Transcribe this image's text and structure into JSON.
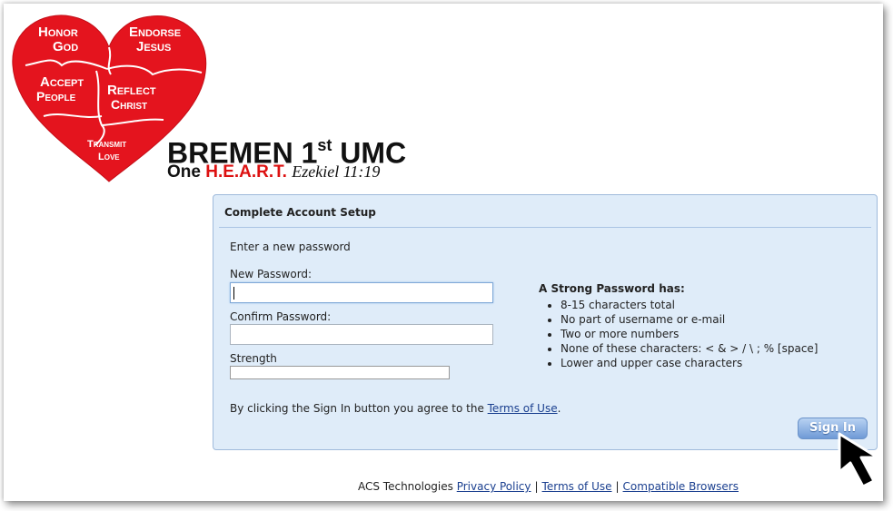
{
  "logo": {
    "pieces": [
      "Honor",
      "God",
      "Endorse",
      "Jesus",
      "Accept",
      "People",
      "Reflect",
      "Christ",
      "Transmit",
      "Love"
    ],
    "heart_color": "#e4141e"
  },
  "church": {
    "name_main": "BREMEN 1",
    "name_sup": "st",
    "name_end": " UMC",
    "tagline_prefix": "One ",
    "tagline_heart": "H.E.A.R.T.",
    "tagline_verse": "Ezekiel 11:19"
  },
  "panel": {
    "title": "Complete Account Setup",
    "instruction": "Enter a new password",
    "new_password_label": "New Password:",
    "new_password_value": "",
    "confirm_password_label": "Confirm Password:",
    "confirm_password_value": "",
    "strength_label": "Strength",
    "strength_level": 0,
    "rules_title": "A Strong Password has:",
    "rules": [
      "8-15 characters total",
      "No part of username or e-mail",
      "Two or more numbers",
      "None of these characters: < & > / \\ ; % [space]",
      "Lower and upper case characters"
    ],
    "agree_prefix": "By clicking the Sign In button you agree to the ",
    "agree_link": "Terms of Use",
    "agree_suffix": ".",
    "signin_label": "Sign In"
  },
  "footer": {
    "prefix": "ACS Technologies ",
    "privacy": "Privacy Policy",
    "sep": "|",
    "terms": "Terms of Use",
    "browsers": "Compatible Browsers"
  },
  "colors": {
    "panel_bg": "#dfecf9",
    "panel_border": "#9fbadb",
    "link": "#1a3f8f",
    "button": "#6f9ad6",
    "heart_text": "#d11111"
  }
}
